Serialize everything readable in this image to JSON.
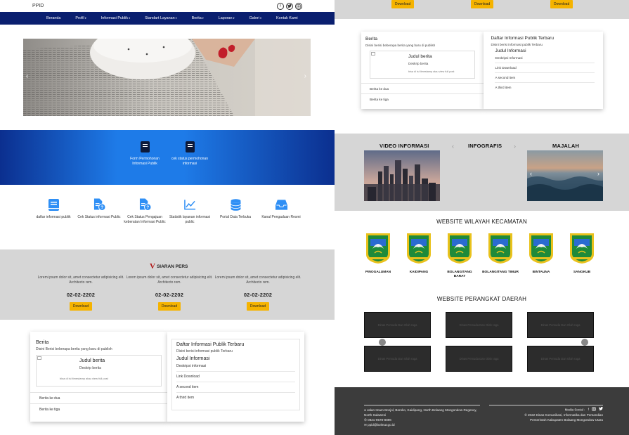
{
  "header": {
    "brand": "PPID",
    "social_icons": [
      "facebook-icon",
      "twitter-icon",
      "instagram-icon"
    ]
  },
  "nav": {
    "items": [
      {
        "label": "Beranda",
        "dropdown": false
      },
      {
        "label": "Profil",
        "dropdown": true
      },
      {
        "label": "Informasi Publik",
        "dropdown": true
      },
      {
        "label": "Standart Layanan",
        "dropdown": true
      },
      {
        "label": "Berita",
        "dropdown": true
      },
      {
        "label": "Laporan",
        "dropdown": true
      },
      {
        "label": "Galeri",
        "dropdown": true
      },
      {
        "label": "Kontak Kami",
        "dropdown": false
      }
    ],
    "color": "#0a1f6f"
  },
  "quick_links": [
    {
      "label": "Form Permohonan Informasi Publik",
      "icon": "book-icon"
    },
    {
      "label": "cek status permohonan informasi",
      "icon": "book-icon"
    }
  ],
  "services": [
    {
      "label": "daftar informasi publik",
      "icon": "book-icon"
    },
    {
      "label": "Cek Status informasi Public",
      "icon": "file-question-icon"
    },
    {
      "label": "Cek Status Pengajuan keberatan Informasi Public",
      "icon": "file-question-icon"
    },
    {
      "label": "Statistik layanan informasi public",
      "icon": "chart-line-icon"
    },
    {
      "label": "Portal Data Terbuka",
      "icon": "database-icon"
    },
    {
      "label": "Kanal Pengaduan Resmi",
      "icon": "inbox-icon"
    }
  ],
  "press": {
    "logo_text": "SIARAN PERS",
    "items": [
      {
        "text": "Lorem ipsum dolor sit, amet consectetur adipisicing elit. Architecto rem.",
        "date": "02-02-2202",
        "button": "Download"
      },
      {
        "text": "Lorem ipsum dolor sit, amet consectetur adipisicing elit. Architecto rem.",
        "date": "02-02-2202",
        "button": "Download"
      },
      {
        "text": "Lorem ipsum dolor sit, amet consectetur adipisicing elit. Architecto rem.",
        "date": "02-02-2202",
        "button": "Download"
      }
    ]
  },
  "berita": {
    "title": "Berita",
    "subtitle": "Disini Berisi beberapa berita yang baru di publish",
    "card_title": "Judul berita",
    "card_desc": "Deskrip berita",
    "card_time": "bisa di isi timestamp atau view full post",
    "items": [
      "Berita ke dua",
      "Berita ke tiga"
    ]
  },
  "berita_small": {
    "subtitle": "Disini berisi beberapa berita yang baru di publish",
    "card_desc": "Deskrip berita"
  },
  "daftar": {
    "title": "Daftar Informasi Publik Terbaru",
    "subtitle": "Disini berisi informasi publik Terbaru",
    "doc_title": "Judul Informasi",
    "rows": [
      "Deskripsi informasi",
      "Link Download",
      "A second item",
      "A third item"
    ]
  },
  "daftar_small": {
    "doc_rows": [
      "Deskripsi Informasi",
      "Link Download",
      "A second item",
      "A third item"
    ]
  },
  "download_label": "Download",
  "media": {
    "video": "VIDEO INFORMASI",
    "infografis": "INFOGRAFIS",
    "majalah": "MAJALAH"
  },
  "kecamatan": {
    "title": "WEBSITE WILAYAH KECAMATAN",
    "items": [
      "PINOGALUMAN",
      "KAIDIPANG",
      "BOLANGITANG BARAT",
      "BOLANGITANG TIMUR",
      "BINTAUNA",
      "SANGKUB"
    ]
  },
  "opd": {
    "title": "WEBSITE PERANGKAT DAERAH",
    "placeholder": "Dinas Pemuda Dan Olah raga"
  },
  "footer": {
    "address": "Jalan Imam Bonjol, Boroko, Kaidipang, North Bolaang Mongondow Regency, North Sulawesi",
    "phone": "0821-9578-8896",
    "email": "ppid@bolmut.go.id",
    "media_social_label": "Media Social :",
    "copyright_line1": "© 2022 Dinas Komunikasi, Informatika dan Persandian",
    "copyright_line2": "Pemerintah Kabupaten Bolaang Mongondow Utara"
  },
  "colors": {
    "accent_yellow": "#f5b300",
    "navy": "#0a1f6f",
    "blue": "#1e7be8",
    "icon_blue": "#2f8ff5"
  }
}
